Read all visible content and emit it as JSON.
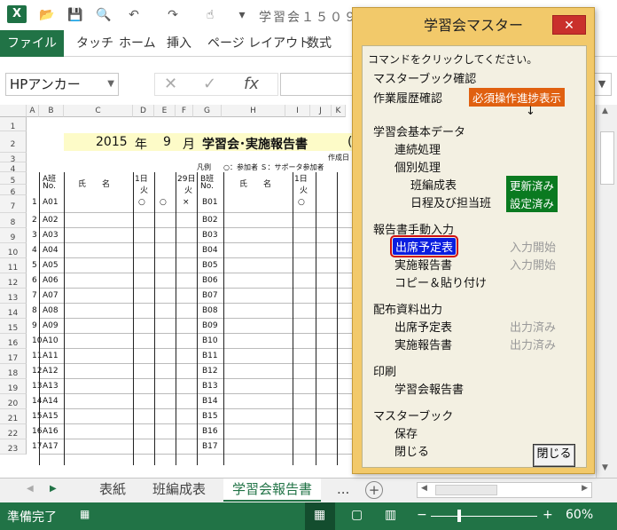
{
  "titlebar": {
    "title": "学習会１５０９"
  },
  "ribbon": {
    "file": "ファイル",
    "tabs": [
      "タッチ",
      "ホーム",
      "挿入",
      "ページ レイアウト",
      "数式"
    ]
  },
  "formula_bar": {
    "name_box": "HPアンカー"
  },
  "sheet": {
    "columns": [
      "A",
      "B",
      "C",
      "D",
      "E",
      "F",
      "G",
      "H",
      "I",
      "J",
      "K"
    ],
    "rows": [
      "1",
      "2",
      "3",
      "4",
      "5",
      "6",
      "7",
      "8",
      "9",
      "10",
      "11",
      "12",
      "13",
      "14",
      "15",
      "16",
      "17",
      "18",
      "19",
      "20",
      "21",
      "22",
      "23"
    ],
    "row_nums": [
      "1",
      "2",
      "3",
      "4",
      "5",
      "6",
      "7",
      "8",
      "9",
      "10",
      "11",
      "12",
      "13",
      "14",
      "15",
      "16",
      "17"
    ],
    "a_ids": [
      "A01",
      "A02",
      "A03",
      "A04",
      "A05",
      "A06",
      "A07",
      "A08",
      "A09",
      "A10",
      "A11",
      "A12",
      "A13",
      "A14",
      "A15",
      "A16",
      "A17"
    ],
    "b_ids": [
      "B01",
      "B02",
      "B03",
      "B04",
      "B05",
      "B06",
      "B07",
      "B08",
      "B09",
      "B10",
      "B11",
      "B12",
      "B13",
      "B14",
      "B15",
      "B16",
      "B17"
    ],
    "year": "2015",
    "year_unit": "年",
    "month": "9",
    "month_unit": "月",
    "title": "学習会･実施報告書",
    "paren": "(",
    "created": "作成日",
    "legend_label": "凡例",
    "legend": "○：参加者 Ｓ：サポータ参加者",
    "a_header": "A班",
    "b_header": "B班",
    "no": "No.",
    "name_header": "氏　　名",
    "day1": "1日",
    "day29": "29日",
    "weekday": "火",
    "marks": [
      "○",
      "○",
      "×"
    ],
    "b_mark": "○"
  },
  "sheet_tabs": [
    "表紙",
    "班編成表",
    "学習会報告書",
    "..."
  ],
  "status": {
    "ready": "準備完了",
    "zoom": "60%"
  },
  "dialog": {
    "title": "学習会マスター",
    "close_x": "✕",
    "prompt": "コマンドをクリックしてください。",
    "master_check": "マスターブック確認",
    "history_check": "作業履歴確認",
    "required_btn": "必須操作進捗表示",
    "arrow": "↓",
    "basic_data": "学習会基本データ",
    "continuous": "連続処理",
    "individual": "個別処理",
    "class_form": "班編成表",
    "class_form_status": "更新済み",
    "schedule": "日程及び担当班",
    "schedule_status": "設定済み",
    "manual_input": "報告書手動入力",
    "attendance_plan": "出席予定表",
    "attendance_status": "入力開始",
    "report": "実施報告書",
    "report_status": "入力開始",
    "copy_paste": "コピー＆貼り付け",
    "output": "配布資料出力",
    "out_attendance": "出席予定表",
    "out_attendance_status": "出力済み",
    "out_report": "実施報告書",
    "out_report_status": "出力済み",
    "print": "印刷",
    "print_report": "学習会報告書",
    "masterbook": "マスターブック",
    "save": "保存",
    "close_book": "閉じる",
    "close_btn": "閉じる"
  }
}
